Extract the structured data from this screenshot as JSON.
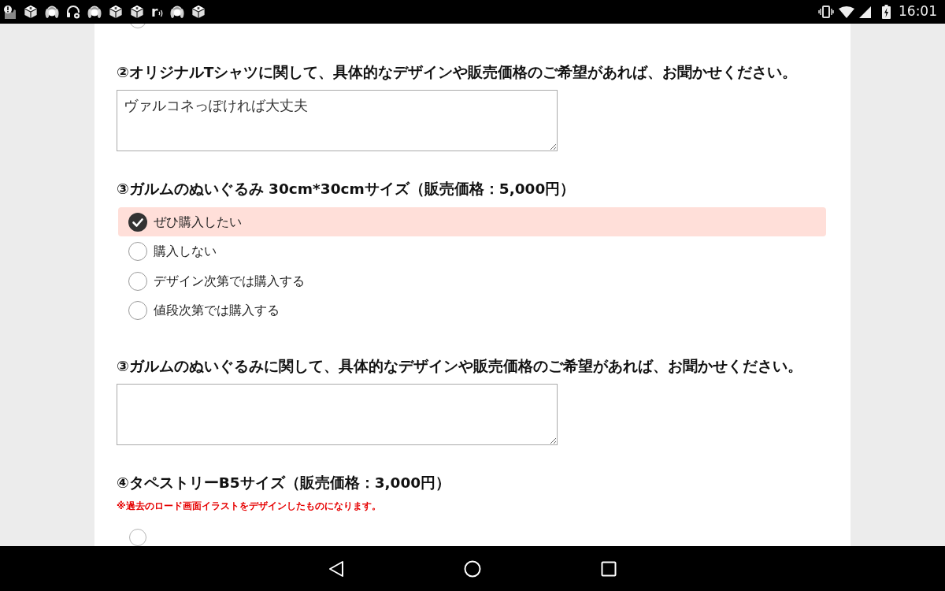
{
  "status_bar": {
    "notifications": [
      {
        "kind": "alert"
      },
      {
        "kind": "cube"
      },
      {
        "kind": "girl"
      },
      {
        "kind": "headphones"
      },
      {
        "kind": "girl"
      },
      {
        "kind": "cube"
      },
      {
        "kind": "cube"
      },
      {
        "kind": "letter",
        "letter": "r"
      },
      {
        "kind": "girl"
      },
      {
        "kind": "cube"
      }
    ],
    "time": "16:01"
  },
  "form": {
    "items": [
      {
        "kind": "radio_edge"
      },
      {
        "kind": "question",
        "label": "②オリジナルTシャツに関して、具体的なデザインや販売価格のご希望があれば、お聞かせください。"
      },
      {
        "kind": "textarea",
        "value": "ヴァルコネっぽければ大丈夫"
      },
      {
        "kind": "question",
        "label": "③ガルムのぬいぐるみ 30cm*30cmサイズ（販売価格：5,000円）"
      },
      {
        "kind": "radio",
        "label": "ぜひ購入したい",
        "selected": true
      },
      {
        "kind": "radio",
        "label": "購入しない",
        "selected": false
      },
      {
        "kind": "radio",
        "label": "デザイン次第では購入する",
        "selected": false
      },
      {
        "kind": "radio",
        "label": "値段次第では購入する",
        "selected": false
      },
      {
        "kind": "question",
        "label": "③ガルムのぬいぐるみに関して、具体的なデザインや販売価格のご希望があれば、お聞かせください。"
      },
      {
        "kind": "textarea"
      },
      {
        "kind": "question",
        "label": "④タペストリーB5サイズ（販売価格：3,000円）"
      },
      {
        "kind": "note",
        "text": "※過去のロード画面イラストをデザインしたものになります。"
      },
      {
        "kind": "radio_partial",
        "selected": false
      }
    ]
  }
}
